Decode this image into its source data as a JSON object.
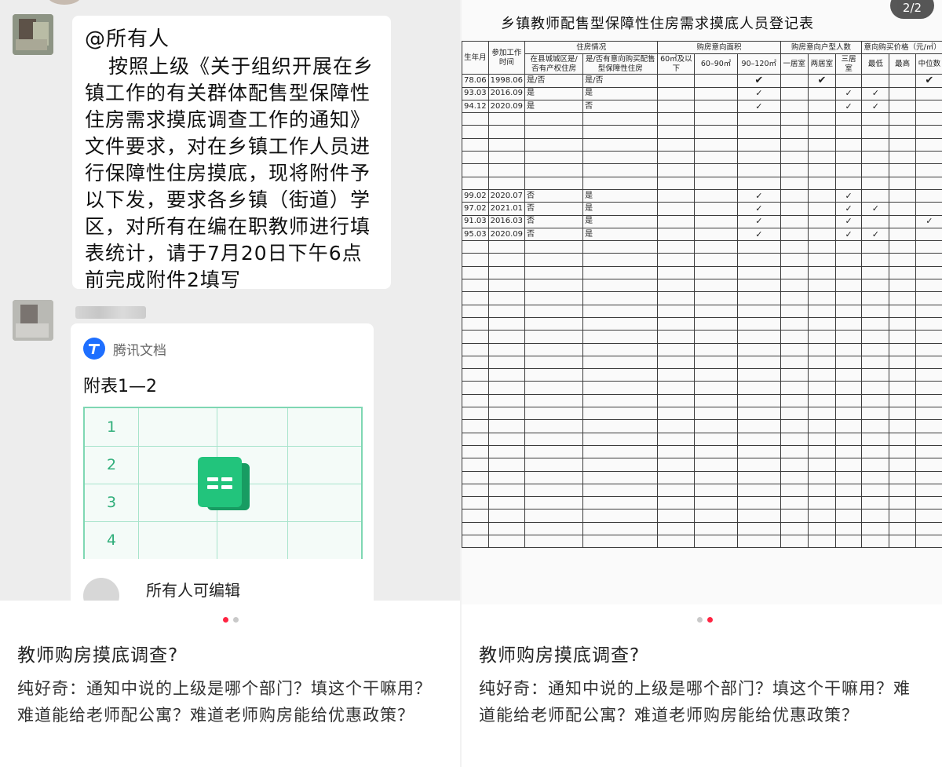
{
  "left": {
    "chat": {
      "mention": "@所有人",
      "message": "按照上级《关于组织开展在乡镇工作的有关群体配售型保障性住房需求摸底调查工作的通知》文件要求，对在乡镇工作人员进行保障性住房摸底，现将附件予以下发，要求各乡镇（街道）学区，对所有在编在职教师进行填表统计，请于7月20日下午6点前完成附件2填写",
      "doc_card": {
        "source": "腾讯文档",
        "title": "附表1—2",
        "row_numbers": [
          "1",
          "2",
          "3",
          "4"
        ],
        "permission": "所有人可编辑"
      }
    },
    "post": {
      "title": "教师购房摸底调查?",
      "body": "纯好奇：通知中说的上级是哪个部门？填这个干嘛用？难道能给老师配公寓？难道老师购房能给优惠政策？"
    },
    "dots": {
      "count": 2,
      "active": 0
    }
  },
  "right": {
    "page_indicator": "2/2",
    "table": {
      "title": "乡镇教师配售型保障性住房需求摸底人员登记表",
      "group_headers": {
        "housing": "住房情况",
        "area": "购房意向面积",
        "rooms": "购房意向户型人数",
        "price": "意向购买价格（元/㎡）"
      },
      "sub_headers": {
        "birth": "生年月",
        "work": "参加工作时间",
        "own_house": "在县城城区是/否有产权住房",
        "intent": "是/否有意向购买配售型保障性住房",
        "a1": "60㎡及以下",
        "a2": "60–90㎡",
        "a3": "90–120㎡",
        "r1": "一居室",
        "r2": "两居室",
        "r3": "三居室",
        "p1": "最低",
        "p2": "最高",
        "p3": "中位数"
      },
      "rows": [
        {
          "birth": "78.06",
          "work": "1998.06",
          "own": "是/否",
          "intent": "是/否",
          "a3": "✔",
          "r2": "✔",
          "p3": "✔",
          "bold": true
        },
        {
          "birth": "93.03",
          "work": "2016.09",
          "own": "是",
          "intent": "是",
          "a3": "✓",
          "r3": "✓",
          "p1": "✓"
        },
        {
          "birth": "94.12",
          "work": "2020.09",
          "own": "是",
          "intent": "否",
          "a3": "✓",
          "r3": "✓",
          "p1": "✓"
        },
        {},
        {},
        {},
        {},
        {},
        {},
        {
          "birth": "99.02",
          "work": "2020.07",
          "own": "否",
          "intent": "是",
          "a3": "✓",
          "r3": "✓"
        },
        {
          "birth": "97.02",
          "work": "2021.01",
          "own": "否",
          "intent": "是",
          "a3": "✓",
          "r3": "✓",
          "p1": "✓"
        },
        {
          "birth": "91.03",
          "work": "2016.03",
          "own": "否",
          "intent": "是",
          "a3": "✓",
          "r3": "✓",
          "p3": "✓"
        },
        {
          "birth": "95.03",
          "work": "2020.09",
          "own": "否",
          "intent": "是",
          "a3": "✓",
          "r3": "✓",
          "p1": "✓"
        }
      ],
      "empty_rows_after": 24
    },
    "post": {
      "title": "教师购房摸底调查?",
      "body": "纯好奇：通知中说的上级是哪个部门？填这个干嘛用？难道能给老师配公寓？难道老师购房能给优惠政策？"
    },
    "dots": {
      "count": 2,
      "active": 1
    }
  },
  "colors": {
    "accent_dot": "#ff2442",
    "sheet_green": "#22c47c",
    "tencent_blue": "#1e6fff"
  }
}
